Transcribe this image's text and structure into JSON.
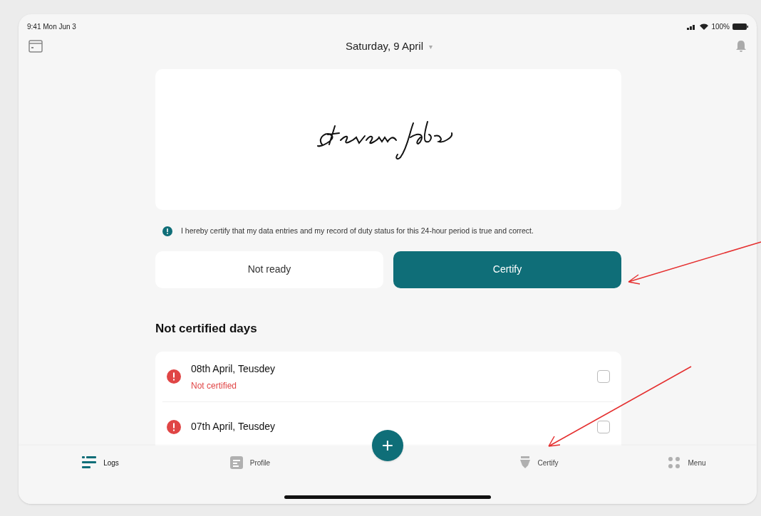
{
  "status_bar": {
    "time": "9:41 Mon Jun 3",
    "battery": "100%"
  },
  "header": {
    "date": "Saturday, 9 April",
    "dropdown_glyph": "▾"
  },
  "certification": {
    "statement": "I hereby certify that my data entries and my record of duty status for this 24-hour period is true and correct.",
    "buttons": [
      {
        "label": "Not ready",
        "kind": "secondary"
      },
      {
        "label": "Certify",
        "kind": "primary"
      }
    ]
  },
  "not_certified": {
    "title": "Not certified days",
    "items": [
      {
        "date": "08th April, Teusdey",
        "status": "Not certified",
        "checked": false
      },
      {
        "date": "07th April, Teusdey",
        "checked": false
      }
    ]
  },
  "fab": {
    "glyph": "+"
  },
  "tab_bar": [
    {
      "label": "Logs",
      "kind": "list",
      "selected": true
    },
    {
      "label": "Profile",
      "kind": "doc",
      "selected": false
    },
    {
      "label": "Certify",
      "kind": "pen",
      "selected": false
    },
    {
      "label": "Menu",
      "kind": "grid",
      "selected": false
    }
  ]
}
